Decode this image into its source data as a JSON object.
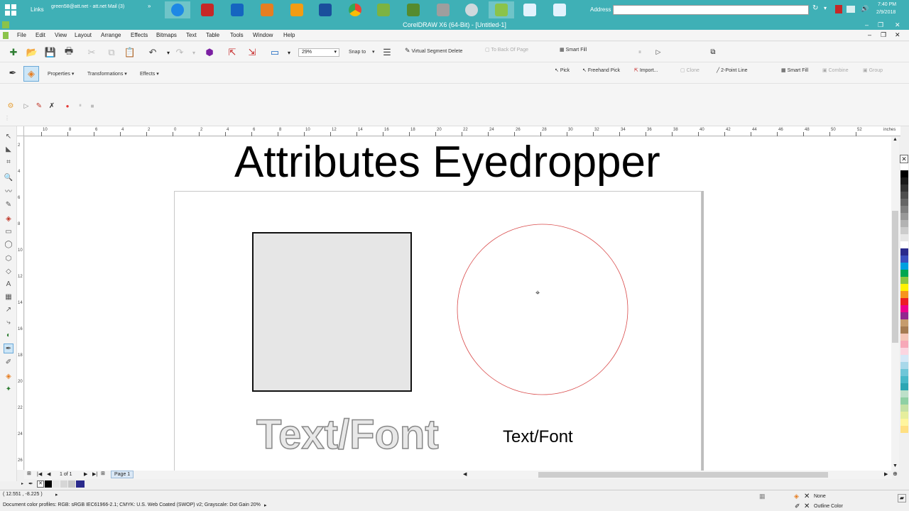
{
  "taskbar": {
    "links_label": "Links",
    "mail_label": "green58@att.net - att.net Mail (3)",
    "address_label": "Address",
    "address_value": "",
    "clock_time": "7:40 PM",
    "clock_date": "2/9/2018"
  },
  "window": {
    "title": "CorelDRAW X6 (64-Bit) - [Untitled-1]"
  },
  "menu": {
    "items": [
      "File",
      "Edit",
      "View",
      "Layout",
      "Arrange",
      "Effects",
      "Bitmaps",
      "Text",
      "Table",
      "Tools",
      "Window",
      "Help"
    ]
  },
  "standard_toolbar": {
    "zoom": "29%",
    "snap_to": "Snap to",
    "virtual_segment_delete": "Virtual Segment Delete",
    "to_back_of_page": "To Back Of Page",
    "smart_fill": "Smart Fill"
  },
  "property_bar": {
    "properties": "Properties",
    "transformations": "Transformations",
    "effects": "Effects",
    "pick": "Pick",
    "freehand_pick": "Freehand Pick",
    "import": "Import...",
    "clone": "Clone",
    "two_point_line": "2-Point Line",
    "smart_fill": "Smart Fill",
    "combine": "Combine",
    "group": "Group"
  },
  "ruler": {
    "h_labels": [
      "10",
      "8",
      "6",
      "4",
      "2",
      "0",
      "2",
      "4",
      "6",
      "8",
      "10",
      "12",
      "14",
      "16",
      "18",
      "20",
      "22",
      "24",
      "26",
      "28",
      "30",
      "32",
      "34",
      "36",
      "38",
      "40",
      "42",
      "44",
      "46",
      "48",
      "50",
      "52"
    ],
    "units": "inches",
    "v_labels": [
      "2",
      "4",
      "6",
      "8",
      "10",
      "12",
      "14",
      "16",
      "18",
      "20",
      "22",
      "24",
      "26"
    ]
  },
  "canvas": {
    "heading": "Attributes Eyedropper",
    "outlined_text": "Text/Font",
    "plain_text": "Text/Font"
  },
  "pager": {
    "page_count": "1 of 1",
    "page_tab": "Page 1"
  },
  "status": {
    "coordinates": "( 12.551 , -8.225 )",
    "color_profiles": "Document color profiles: RGB: sRGB IEC61966-2.1; CMYK: U.S. Web Coated (SWOP) v2; Grayscale: Dot Gain 20%",
    "fill_label": "None",
    "outline_label": "Outline Color"
  },
  "colors": {
    "taskbar": "#3fb0b6",
    "circle_outline": "#d94a4a",
    "rect_fill": "#e6e6e6",
    "palette": [
      "#ffffff",
      "#000000",
      "#1a1a1a",
      "#333333",
      "#4d4d4d",
      "#666666",
      "#808080",
      "#999999",
      "#b3b3b3",
      "#cccccc",
      "#e6e6e6",
      "#ffffff",
      "#2a2a8c",
      "#3b4fbf",
      "#00a0e0",
      "#00a650",
      "#8cc63f",
      "#fff200",
      "#f7941d",
      "#ed1c24",
      "#ec008c",
      "#92278f",
      "#c69c6d",
      "#a67c52",
      "#f5c7b8",
      "#f7a8b8",
      "#fbd5e0",
      "#d5e8f7",
      "#a8d8ea",
      "#6ec6d8",
      "#47b8c8",
      "#2ba6b3",
      "#bde0c9",
      "#8fd0a4",
      "#c5e1a5",
      "#e6ee9c",
      "#fff59d",
      "#ffe082"
    ]
  }
}
